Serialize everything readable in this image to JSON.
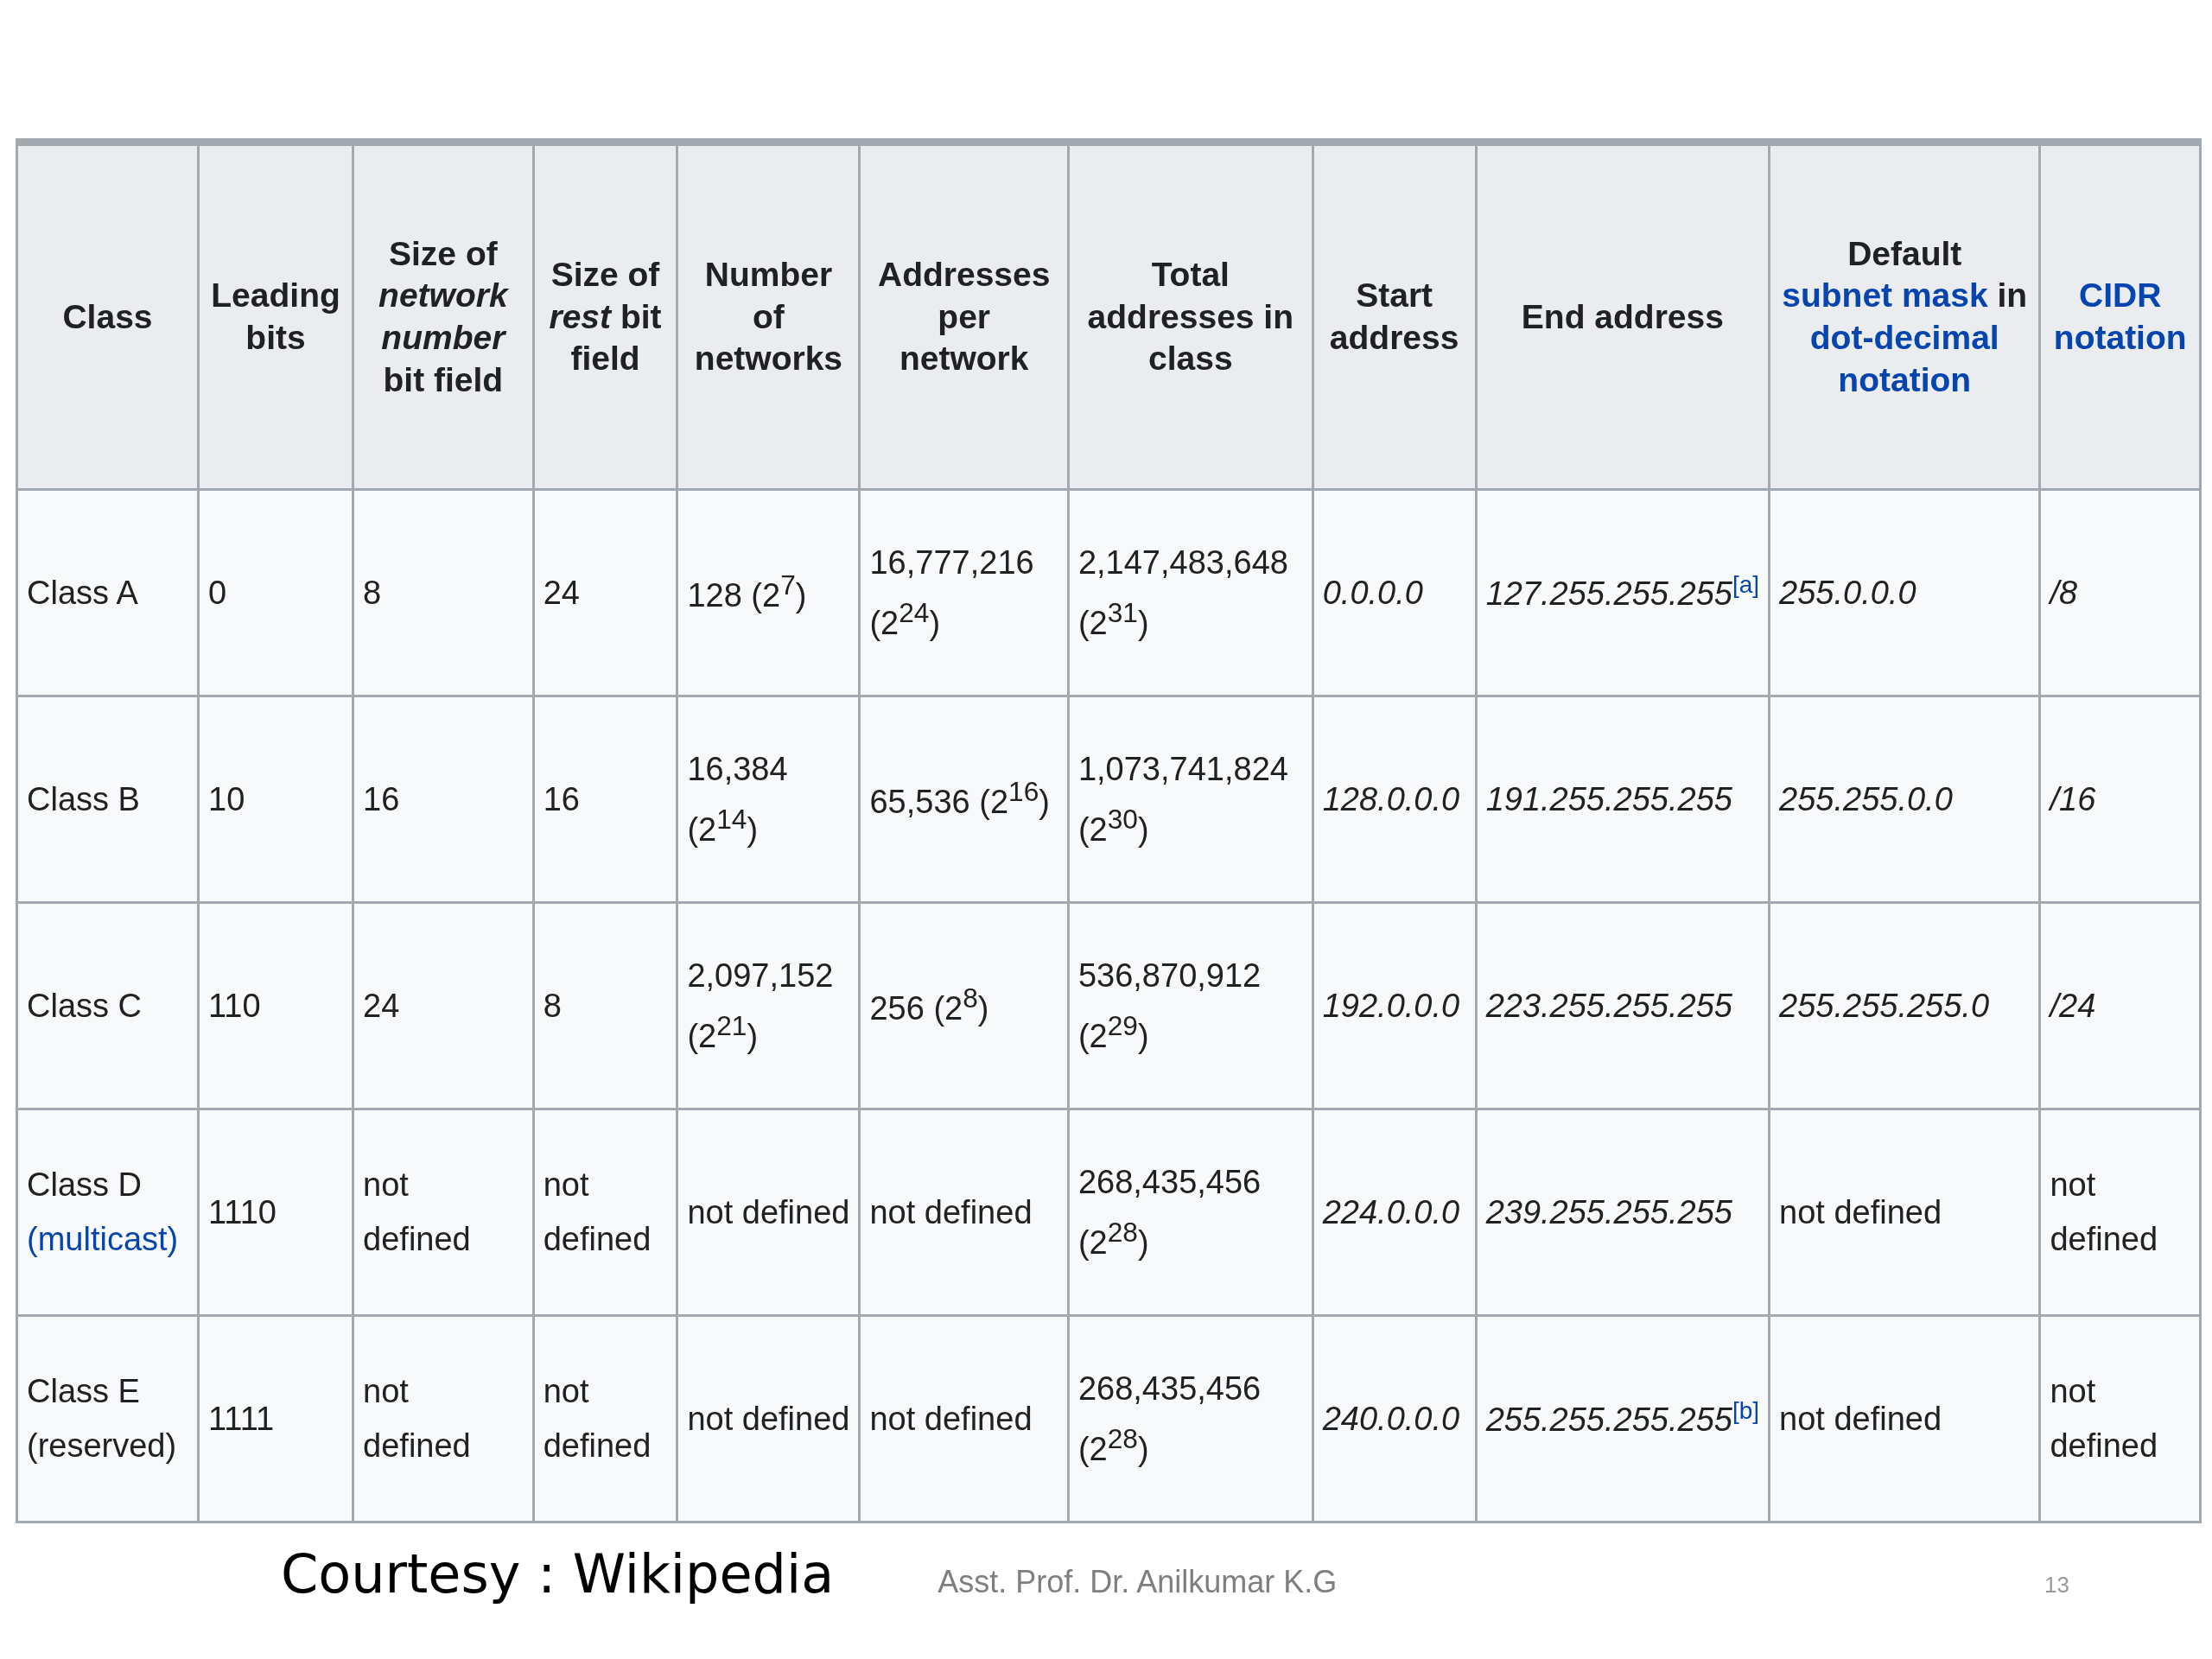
{
  "table": {
    "columns": [
      {
        "parts": [
          {
            "kind": "text",
            "text": "Class"
          }
        ]
      },
      {
        "parts": [
          {
            "kind": "text",
            "text": "Leading bits"
          }
        ]
      },
      {
        "parts": [
          {
            "kind": "text",
            "text": "Size of *network number* bit field"
          }
        ]
      },
      {
        "parts": [
          {
            "kind": "text",
            "text": "Size of *rest* bit field"
          }
        ]
      },
      {
        "parts": [
          {
            "kind": "text",
            "text": "Number of networks"
          }
        ]
      },
      {
        "parts": [
          {
            "kind": "text",
            "text": "Addresses per network"
          }
        ]
      },
      {
        "parts": [
          {
            "kind": "text",
            "text": "Total addresses in class"
          }
        ]
      },
      {
        "parts": [
          {
            "kind": "text",
            "text": "Start address"
          }
        ]
      },
      {
        "parts": [
          {
            "kind": "text",
            "text": "End address"
          }
        ]
      },
      {
        "parts": [
          {
            "kind": "text",
            "text": "Default"
          },
          {
            "kind": "link",
            "text": "subnet mask"
          },
          {
            "kind": "text",
            "text": "in"
          },
          {
            "kind": "link",
            "text": "dot-decimal notation"
          }
        ]
      },
      {
        "parts": [
          {
            "kind": "link",
            "text": "CIDR notation"
          }
        ]
      }
    ],
    "rows": [
      [
        [
          {
            "kind": "text",
            "text": "Class A"
          }
        ],
        [
          {
            "kind": "text",
            "text": "0"
          }
        ],
        [
          {
            "kind": "text",
            "text": "8"
          }
        ],
        [
          {
            "kind": "text",
            "text": "24"
          }
        ],
        [
          {
            "kind": "text",
            "text": "128 (2$^{7}$)"
          }
        ],
        [
          {
            "kind": "text",
            "text": "16,777,216 (2$^{24}$)"
          }
        ],
        [
          {
            "kind": "text",
            "text": "2,147,483,648 (2$^{31}$)"
          }
        ],
        [
          {
            "kind": "address",
            "text": "0.0.0.0"
          }
        ],
        [
          {
            "kind": "address",
            "text": "127.255.255.255"
          },
          {
            "kind": "note",
            "text": "[a]"
          }
        ],
        [
          {
            "kind": "address",
            "text": "255.0.0.0"
          }
        ],
        [
          {
            "kind": "address",
            "text": "/8"
          }
        ]
      ],
      [
        [
          {
            "kind": "text",
            "text": "Class B"
          }
        ],
        [
          {
            "kind": "text",
            "text": "10"
          }
        ],
        [
          {
            "kind": "text",
            "text": "16"
          }
        ],
        [
          {
            "kind": "text",
            "text": "16"
          }
        ],
        [
          {
            "kind": "text",
            "text": "16,384 (2$^{14}$)"
          }
        ],
        [
          {
            "kind": "text",
            "text": "65,536 (2$^{16}$)"
          }
        ],
        [
          {
            "kind": "text",
            "text": "1,073,741,824 (2$^{30}$)"
          }
        ],
        [
          {
            "kind": "address",
            "text": "128.0.0.0"
          }
        ],
        [
          {
            "kind": "address",
            "text": "191.255.255.255"
          }
        ],
        [
          {
            "kind": "address",
            "text": "255.255.0.0"
          }
        ],
        [
          {
            "kind": "address",
            "text": "/16"
          }
        ]
      ],
      [
        [
          {
            "kind": "text",
            "text": "Class C"
          }
        ],
        [
          {
            "kind": "text",
            "text": "110"
          }
        ],
        [
          {
            "kind": "text",
            "text": "24"
          }
        ],
        [
          {
            "kind": "text",
            "text": "8"
          }
        ],
        [
          {
            "kind": "text",
            "text": "2,097,152 (2$^{21}$)"
          }
        ],
        [
          {
            "kind": "text",
            "text": "256 (2$^{8}$)"
          }
        ],
        [
          {
            "kind": "text",
            "text": "536,870,912 (2$^{29}$)"
          }
        ],
        [
          {
            "kind": "address",
            "text": "192.0.0.0"
          }
        ],
        [
          {
            "kind": "address",
            "text": "223.255.255.255"
          }
        ],
        [
          {
            "kind": "address",
            "text": "255.255.255.0"
          }
        ],
        [
          {
            "kind": "address",
            "text": "/24"
          }
        ]
      ],
      [
        [
          {
            "kind": "text",
            "text": "Class D"
          },
          {
            "kind": "link",
            "text": "(multicast)"
          }
        ],
        [
          {
            "kind": "text",
            "text": "1110"
          }
        ],
        [
          {
            "kind": "text",
            "text": "not defined"
          }
        ],
        [
          {
            "kind": "text",
            "text": "not defined"
          }
        ],
        [
          {
            "kind": "text",
            "text": "not defined"
          }
        ],
        [
          {
            "kind": "text",
            "text": "not defined"
          }
        ],
        [
          {
            "kind": "text",
            "text": "268,435,456 (2$^{28}$)"
          }
        ],
        [
          {
            "kind": "address",
            "text": "224.0.0.0"
          }
        ],
        [
          {
            "kind": "address",
            "text": "239.255.255.255"
          }
        ],
        [
          {
            "kind": "text",
            "text": "not defined"
          }
        ],
        [
          {
            "kind": "text",
            "text": "not defined"
          }
        ]
      ],
      [
        [
          {
            "kind": "text",
            "text": "Class E (reserved)"
          }
        ],
        [
          {
            "kind": "text",
            "text": "1111"
          }
        ],
        [
          {
            "kind": "text",
            "text": "not defined"
          }
        ],
        [
          {
            "kind": "text",
            "text": "not defined"
          }
        ],
        [
          {
            "kind": "text",
            "text": "not defined"
          }
        ],
        [
          {
            "kind": "text",
            "text": "not defined"
          }
        ],
        [
          {
            "kind": "text",
            "text": "268,435,456 (2$^{28}$)"
          }
        ],
        [
          {
            "kind": "address",
            "text": "240.0.0.0"
          }
        ],
        [
          {
            "kind": "address",
            "text": "255.255.255.255"
          },
          {
            "kind": "note",
            "text": "[b]"
          }
        ],
        [
          {
            "kind": "text",
            "text": "not defined"
          }
        ],
        [
          {
            "kind": "text",
            "text": "not defined"
          }
        ]
      ]
    ]
  },
  "footer": {
    "courtesy": "Courtesy : Wikipedia",
    "author": "Asst. Prof. Dr. Anilkumar K.G",
    "page": "13"
  }
}
